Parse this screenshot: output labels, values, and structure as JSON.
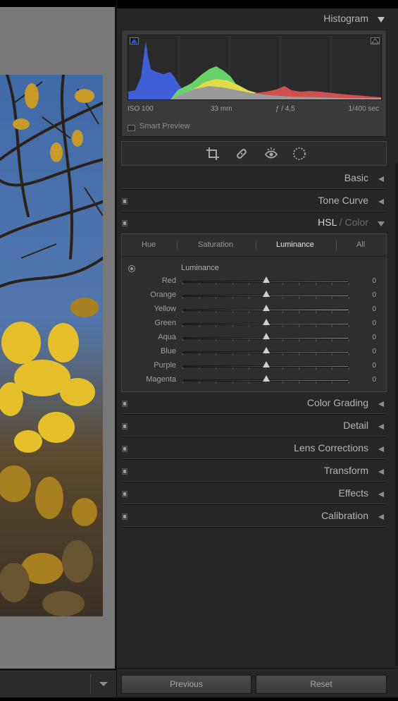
{
  "histogram": {
    "title": "Histogram",
    "iso": "ISO 100",
    "focal_length": "33 mm",
    "aperture": "ƒ / 4,5",
    "shutter": "1/400 sec",
    "smart_preview": "Smart Preview"
  },
  "tools": [
    "crop-icon",
    "heal-icon",
    "red-eye-icon",
    "masking-icon"
  ],
  "sections": {
    "basic": "Basic",
    "tone_curve": "Tone Curve",
    "hsl": "HSL",
    "hsl_sep": " / ",
    "color": "Color",
    "color_grading": "Color Grading",
    "detail": "Detail",
    "lens_corrections": "Lens Corrections",
    "transform": "Transform",
    "effects": "Effects",
    "calibration": "Calibration"
  },
  "hsl_tabs": {
    "hue": "Hue",
    "saturation": "Saturation",
    "luminance": "Luminance",
    "all": "All",
    "active": "Luminance"
  },
  "hsl_panel": {
    "sub_title": "Luminance",
    "sliders": [
      {
        "label": "Red",
        "value": "0",
        "fraction": 0.5,
        "color": "#c0504d"
      },
      {
        "label": "Orange",
        "value": "0",
        "fraction": 0.5,
        "color": "#c08a4d"
      },
      {
        "label": "Yellow",
        "value": "0",
        "fraction": 0.5,
        "color": "#c9c060"
      },
      {
        "label": "Green",
        "value": "0",
        "fraction": 0.5,
        "color": "#6aae58"
      },
      {
        "label": "Aqua",
        "value": "0",
        "fraction": 0.5,
        "color": "#5ab8b0"
      },
      {
        "label": "Blue",
        "value": "0",
        "fraction": 0.5,
        "color": "#5a86c8"
      },
      {
        "label": "Purple",
        "value": "0",
        "fraction": 0.5,
        "color": "#9a62c8"
      },
      {
        "label": "Magenta",
        "value": "0",
        "fraction": 0.5,
        "color": "#c060b0"
      }
    ]
  },
  "footer": {
    "previous": "Previous",
    "reset": "Reset"
  }
}
